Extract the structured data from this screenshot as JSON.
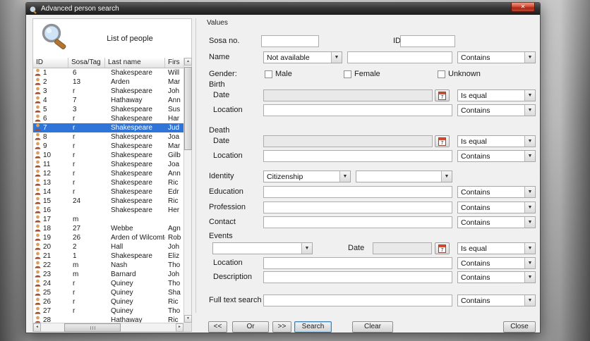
{
  "window": {
    "title": "Advanced person search",
    "close_glyph": "✕"
  },
  "icons": {
    "arrow_up": "▲",
    "arrow_down": "▼",
    "arrow_left": "◄",
    "arrow_right": "►",
    "combo_arrow": "▼"
  },
  "colors": {
    "selection": "#2f74d8",
    "titlebar_dark": "#1c1c1c",
    "close_red": "#c0442c"
  },
  "left_panel": {
    "title": "List of people",
    "table": {
      "columns": [
        "ID",
        "Sosa/Tag",
        "Last name",
        "Firs"
      ],
      "selected_index": 6,
      "rows": [
        {
          "id": "1",
          "sosa": "6",
          "last": "Shakespeare",
          "first": "Will"
        },
        {
          "id": "2",
          "sosa": "13",
          "last": "Arden",
          "first": "Mar"
        },
        {
          "id": "3",
          "sosa": "r",
          "last": "Shakespeare",
          "first": "Joh"
        },
        {
          "id": "4",
          "sosa": "7",
          "last": "Hathaway",
          "first": "Ann"
        },
        {
          "id": "5",
          "sosa": "3",
          "last": "Shakespeare",
          "first": "Sus"
        },
        {
          "id": "6",
          "sosa": "r",
          "last": "Shakespeare",
          "first": "Har"
        },
        {
          "id": "7",
          "sosa": "r",
          "last": "Shakespeare",
          "first": "Jud"
        },
        {
          "id": "8",
          "sosa": "r",
          "last": "Shakespeare",
          "first": "Joa"
        },
        {
          "id": "9",
          "sosa": "r",
          "last": "Shakespeare",
          "first": "Mar"
        },
        {
          "id": "10",
          "sosa": "r",
          "last": "Shakespeare",
          "first": "Gilb"
        },
        {
          "id": "11",
          "sosa": "r",
          "last": "Shakespeare",
          "first": "Joa"
        },
        {
          "id": "12",
          "sosa": "r",
          "last": "Shakespeare",
          "first": "Ann"
        },
        {
          "id": "13",
          "sosa": "r",
          "last": "Shakespeare",
          "first": "Ric"
        },
        {
          "id": "14",
          "sosa": "r",
          "last": "Shakespeare",
          "first": "Edr"
        },
        {
          "id": "15",
          "sosa": "24",
          "last": "Shakespeare",
          "first": "Ric"
        },
        {
          "id": "16",
          "sosa": "",
          "last": "Shakespeare",
          "first": "Her"
        },
        {
          "id": "17",
          "sosa": "m",
          "last": "",
          "first": ""
        },
        {
          "id": "18",
          "sosa": "27",
          "last": "Webbe",
          "first": "Agn"
        },
        {
          "id": "19",
          "sosa": "26",
          "last": "Arden of Wilcomte",
          "first": "Rob"
        },
        {
          "id": "20",
          "sosa": "2",
          "last": "Hall",
          "first": "Joh"
        },
        {
          "id": "21",
          "sosa": "1",
          "last": "Shakespeare",
          "first": "Eliz"
        },
        {
          "id": "22",
          "sosa": "m",
          "last": "Nash",
          "first": "Tho"
        },
        {
          "id": "23",
          "sosa": "m",
          "last": "Barnard",
          "first": "Joh"
        },
        {
          "id": "24",
          "sosa": "r",
          "last": "Quiney",
          "first": "Tho"
        },
        {
          "id": "25",
          "sosa": "r",
          "last": "Quiney",
          "first": "Sha"
        },
        {
          "id": "26",
          "sosa": "r",
          "last": "Quiney",
          "first": "Ric"
        },
        {
          "id": "27",
          "sosa": "r",
          "last": "Quiney",
          "first": "Tho"
        },
        {
          "id": "28",
          "sosa": "",
          "last": "Hathaway",
          "first": "Ric"
        }
      ]
    }
  },
  "form": {
    "section_title": "Values",
    "labels": {
      "sosa": "Sosa no.",
      "id": "ID",
      "name": "Name",
      "gender": "Gender:",
      "birth": "Birth",
      "death": "Death",
      "date": "Date",
      "location": "Location",
      "identity": "Identity",
      "education": "Education",
      "profession": "Profession",
      "contact": "Contact",
      "events": "Events",
      "description": "Description",
      "full_text": "Full text search"
    },
    "name_source_value": "Not available",
    "identity_type_value": "Citizenship",
    "gender_options": [
      "Male",
      "Female",
      "Unknown"
    ],
    "ops": {
      "contains": "Contains",
      "is_equal": "Is equal"
    },
    "calendar_glyph": "7"
  },
  "footer": {
    "prev": "<<",
    "or": "Or",
    "next": ">>",
    "search": "Search",
    "clear": "Clear",
    "close": "Close"
  }
}
